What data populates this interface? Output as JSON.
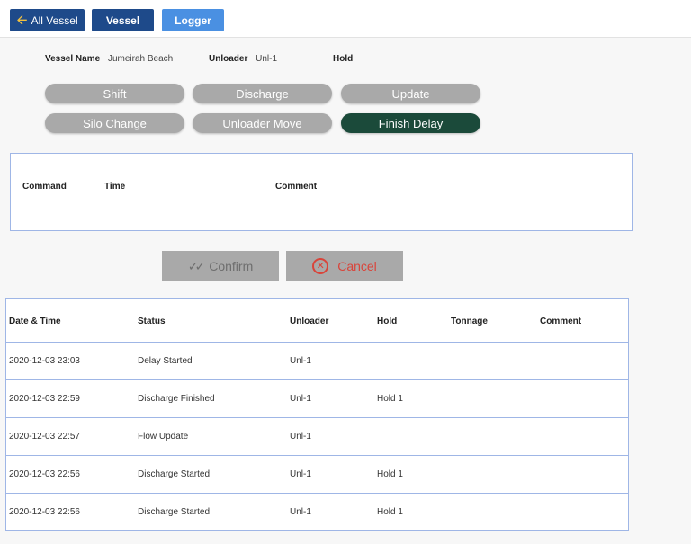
{
  "nav": {
    "all_vessel_label": "All Vessel",
    "vessel_label": "Vessel",
    "logger_label": "Logger"
  },
  "info": {
    "vessel_name_label": "Vessel Name",
    "vessel_name_value": "Jumeirah Beach",
    "unloader_label": "Unloader",
    "unloader_value": "Unl-1",
    "hold_label": "Hold"
  },
  "actions": [
    "Shift",
    "Discharge",
    "Update",
    "Silo Change",
    "Unloader Move",
    "Finish Delay"
  ],
  "command_panel": {
    "headers": [
      "Command",
      "Time",
      "Comment"
    ]
  },
  "buttons": {
    "confirm_label": "Confirm",
    "cancel_label": "Cancel"
  },
  "log_table": {
    "headers": [
      "Date & Time",
      "Status",
      "Unloader",
      "Hold",
      "Tonnage",
      "Comment"
    ],
    "rows": [
      [
        "2020-12-03 23:03",
        "Delay Started",
        "Unl-1",
        "",
        "",
        ""
      ],
      [
        "2020-12-03 22:59",
        "Discharge Finished",
        "Unl-1",
        "Hold 1",
        "",
        ""
      ],
      [
        "2020-12-03 22:57",
        "Flow Update",
        "Unl-1",
        "",
        "",
        ""
      ],
      [
        "2020-12-03 22:56",
        "Discharge Started",
        "Unl-1",
        "Hold 1",
        "",
        ""
      ],
      [
        "2020-12-03 22:56",
        "Discharge Started",
        "Unl-1",
        "Hold 1",
        "",
        ""
      ]
    ]
  },
  "colors": {
    "nav_dark": "#1e4a8a",
    "nav_light": "#4a90e2",
    "pill_gray": "#a9a9a9",
    "pill_active": "#1b4a3a",
    "cancel_red": "#d9443a",
    "panel_border": "#9fb6e6"
  }
}
